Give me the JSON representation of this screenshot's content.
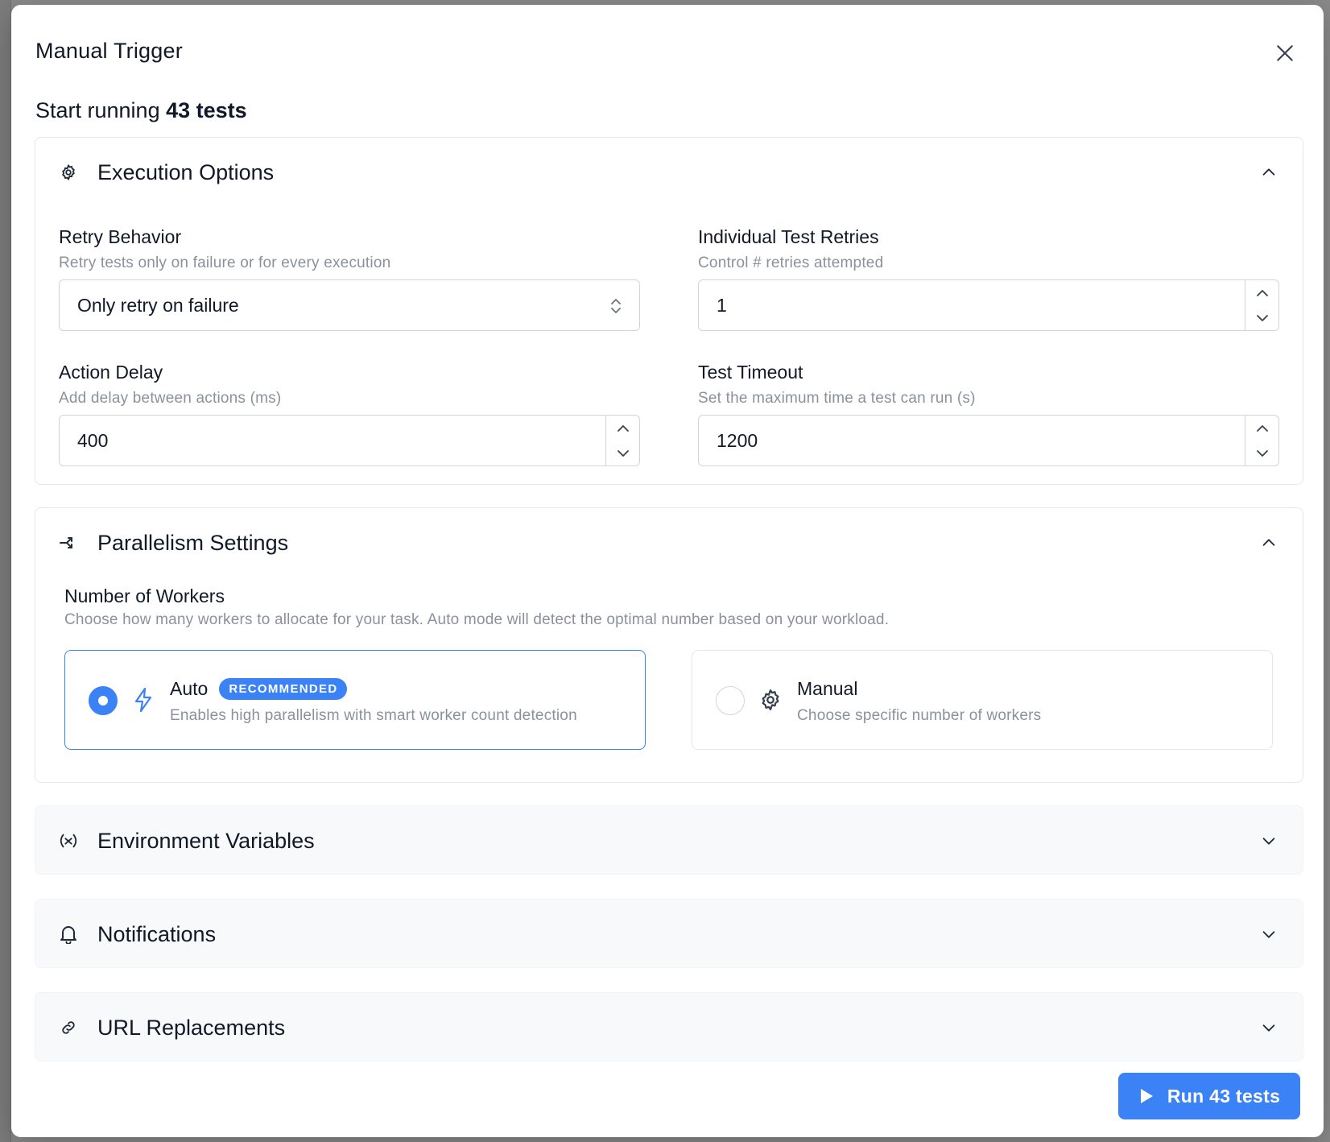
{
  "modal": {
    "title": "Manual Trigger",
    "subtitle_prefix": "Start running",
    "subtitle_bold": "43 tests"
  },
  "execution": {
    "title": "Execution Options",
    "retry_behavior": {
      "label": "Retry Behavior",
      "help": "Retry tests only on failure or for every execution",
      "value": "Only retry on failure"
    },
    "individual_retries": {
      "label": "Individual Test Retries",
      "help": "Control # retries attempted",
      "value": "1"
    },
    "action_delay": {
      "label": "Action Delay",
      "help": "Add delay between actions (ms)",
      "value": "400"
    },
    "test_timeout": {
      "label": "Test Timeout",
      "help": "Set the maximum time a test can run (s)",
      "value": "1200"
    }
  },
  "parallelism": {
    "title": "Parallelism Settings",
    "workers_label": "Number of Workers",
    "workers_help": "Choose how many workers to allocate for your task. Auto mode will detect the optimal number based on your workload.",
    "auto": {
      "title": "Auto",
      "badge": "RECOMMENDED",
      "desc": "Enables high parallelism with smart worker count detection"
    },
    "manual": {
      "title": "Manual",
      "desc": "Choose specific number of workers"
    }
  },
  "sections": {
    "env": "Environment Variables",
    "notifications": "Notifications",
    "url": "URL Replacements"
  },
  "run_button": "Run 43 tests",
  "colors": {
    "accent": "#3b82f6",
    "muted_text": "#8b919c",
    "border": "#e5e7eb"
  }
}
